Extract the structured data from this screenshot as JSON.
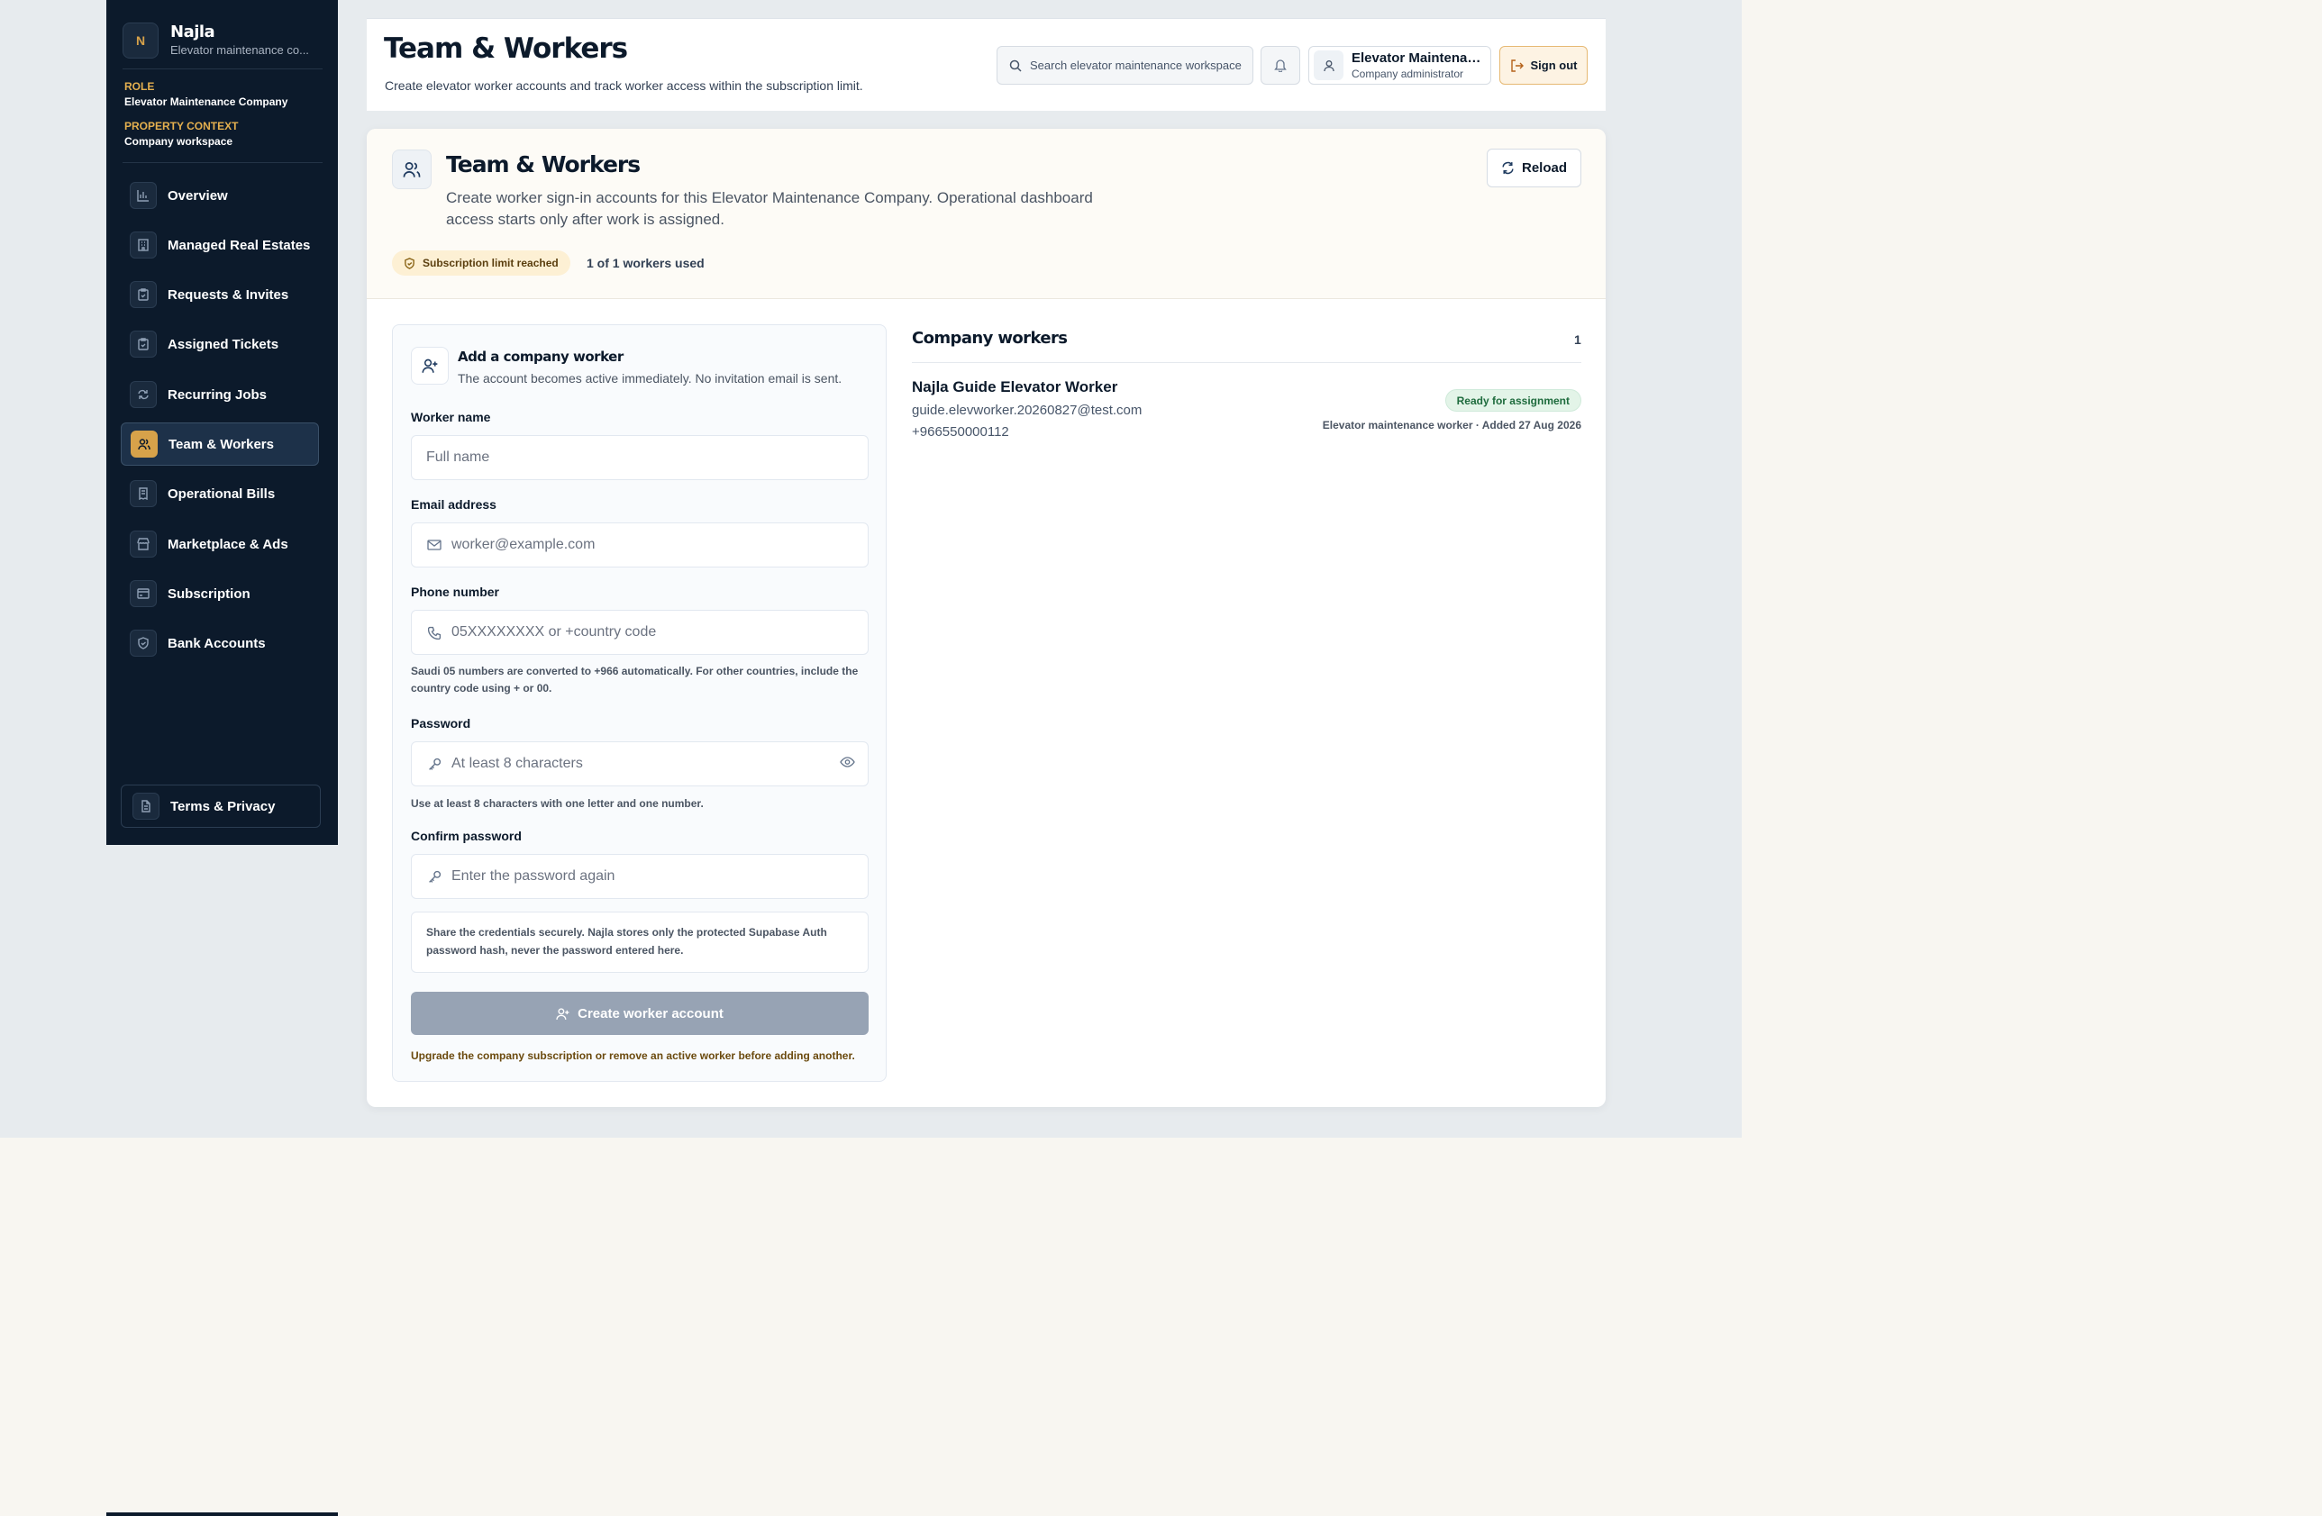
{
  "colors": {
    "sidebar_bg": "#0c1a2b",
    "accent": "#d7a24a",
    "success": "#1e6b3d",
    "disabled_button": "#97a3b4"
  },
  "brand": {
    "logo": "N",
    "name": "Najla",
    "subtitle": "Elevator maintenance co..."
  },
  "context": {
    "role_key": "ROLE",
    "role_value": "Elevator Maintenance Company",
    "property_key": "PROPERTY CONTEXT",
    "property_value": "Company workspace"
  },
  "nav": {
    "items": [
      {
        "label": "Overview",
        "icon": "bar-chart-icon"
      },
      {
        "label": "Managed Real Estates",
        "icon": "building-icon"
      },
      {
        "label": "Requests & Invites",
        "icon": "clipboard-icon"
      },
      {
        "label": "Assigned Tickets",
        "icon": "clipboard-check-icon"
      },
      {
        "label": "Recurring Jobs",
        "icon": "repeat-icon"
      },
      {
        "label": "Team & Workers",
        "icon": "users-icon",
        "active": true
      },
      {
        "label": "Operational Bills",
        "icon": "receipt-icon"
      },
      {
        "label": "Marketplace & Ads",
        "icon": "store-icon"
      },
      {
        "label": "Subscription",
        "icon": "card-icon"
      },
      {
        "label": "Bank Accounts",
        "icon": "shield-icon"
      }
    ],
    "terms": "Terms & Privacy"
  },
  "header": {
    "title": "Team & Workers",
    "subtitle": "Create elevator worker accounts and track worker access within the subscription limit.",
    "search_placeholder": "Search elevator maintenance workspace",
    "user_name": "Elevator Maintenan...",
    "user_role": "Company administrator",
    "signout": "Sign out"
  },
  "main": {
    "title": "Team & Workers",
    "description": "Create worker sign-in accounts for this Elevator Maintenance Company. Operational dashboard access starts only after work is assigned.",
    "reload": "Reload",
    "limit_badge": "Subscription limit reached",
    "usage": "1 of 1 workers used"
  },
  "form": {
    "title": "Add a company worker",
    "subtitle": "The account becomes active immediately. No invitation email is sent.",
    "name_label": "Worker name",
    "name_placeholder": "Full name",
    "email_label": "Email address",
    "email_placeholder": "worker@example.com",
    "phone_label": "Phone number",
    "phone_placeholder": "05XXXXXXXX or +country code",
    "phone_help": "Saudi 05 numbers are converted to +966 automatically. For other countries, include the country code using + or 00.",
    "password_label": "Password",
    "password_placeholder": "At least 8 characters",
    "password_help": "Use at least 8 characters with one letter and one number.",
    "confirm_label": "Confirm password",
    "confirm_placeholder": "Enter the password again",
    "note": "Share the credentials securely. Najla stores only the protected Supabase Auth password hash, never the password entered here.",
    "create_button": "Create worker account",
    "upgrade_note": "Upgrade the company subscription or remove an active worker before adding another."
  },
  "workers": {
    "title": "Company workers",
    "count": "1",
    "items": [
      {
        "name": "Najla Guide Elevator Worker",
        "email": "guide.elevworker.20260827@test.com",
        "phone": "+966550000112",
        "status": "Ready for assignment",
        "meta": "Elevator maintenance worker · Added 27 Aug 2026"
      }
    ]
  }
}
